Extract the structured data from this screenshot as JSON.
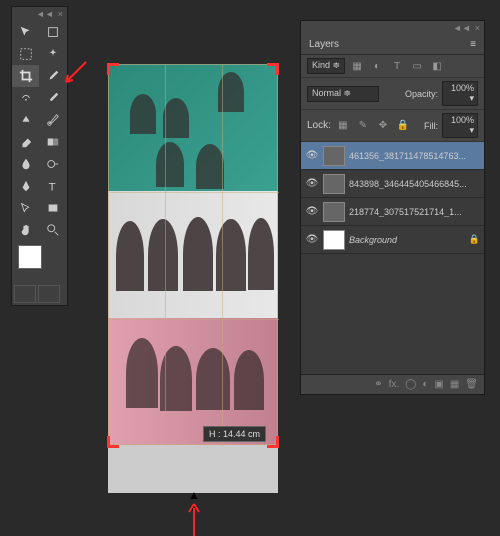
{
  "tools": {
    "collapse": "◄◄",
    "close": "×"
  },
  "canvas": {
    "dim_label": "H :   14.44 cm"
  },
  "layers": {
    "header": {
      "collapse": "◄◄",
      "close": "×"
    },
    "tab": "Layers",
    "menu": "≡",
    "filter_kind": "Kind  ≑",
    "blend_mode": "Normal",
    "blend_arrow": "≑",
    "opacity_label": "Opacity:",
    "opacity_value": "100% ▾",
    "lock_label": "Lock:",
    "fill_label": "Fill:",
    "fill_value": "100% ▾",
    "items": [
      {
        "name": "461356_381711478514763..."
      },
      {
        "name": "843898_346445405466845..."
      },
      {
        "name": "218774_307517521714_1..."
      },
      {
        "name": "Background"
      }
    ]
  }
}
